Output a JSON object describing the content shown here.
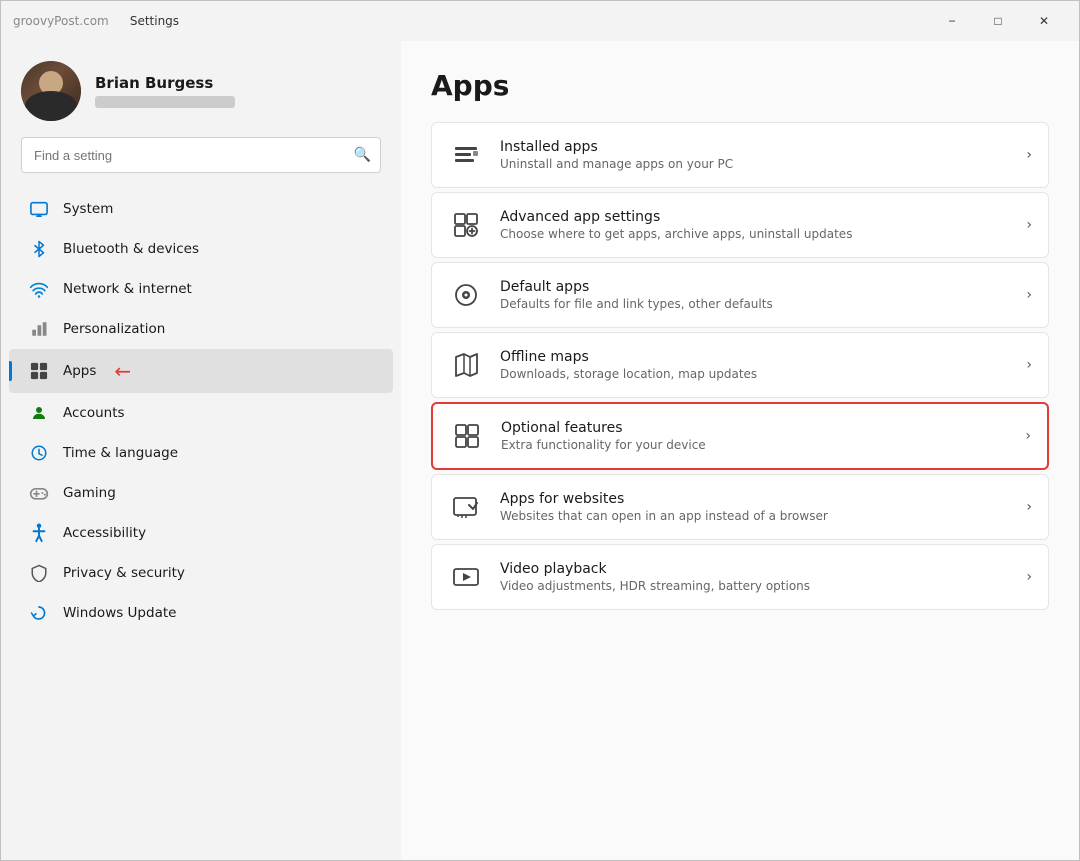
{
  "window": {
    "title": "Settings",
    "watermark": "groovyPost.com"
  },
  "titlebar": {
    "minimize_label": "−",
    "maximize_label": "□",
    "close_label": "✕"
  },
  "sidebar": {
    "user": {
      "name": "Brian Burgess",
      "email_placeholder": "●●●●●●●●●●●●"
    },
    "search": {
      "placeholder": "Find a setting"
    },
    "nav_items": [
      {
        "id": "system",
        "label": "System",
        "icon": "🖥",
        "active": false
      },
      {
        "id": "bluetooth",
        "label": "Bluetooth & devices",
        "icon": "⬡",
        "active": false
      },
      {
        "id": "network",
        "label": "Network & internet",
        "icon": "◈",
        "active": false
      },
      {
        "id": "personalization",
        "label": "Personalization",
        "icon": "✏",
        "active": false
      },
      {
        "id": "apps",
        "label": "Apps",
        "icon": "⊞",
        "active": true
      },
      {
        "id": "accounts",
        "label": "Accounts",
        "icon": "●",
        "active": false
      },
      {
        "id": "time",
        "label": "Time & language",
        "icon": "⊕",
        "active": false
      },
      {
        "id": "gaming",
        "label": "Gaming",
        "icon": "⊛",
        "active": false
      },
      {
        "id": "accessibility",
        "label": "Accessibility",
        "icon": "✶",
        "active": false
      },
      {
        "id": "privacy",
        "label": "Privacy & security",
        "icon": "⊗",
        "active": false
      },
      {
        "id": "windowsupdate",
        "label": "Windows Update",
        "icon": "↺",
        "active": false
      }
    ]
  },
  "main": {
    "page_title": "Apps",
    "settings_items": [
      {
        "id": "installed-apps",
        "title": "Installed apps",
        "desc": "Uninstall and manage apps on your PC",
        "icon": "☰",
        "highlighted": false
      },
      {
        "id": "advanced-app-settings",
        "title": "Advanced app settings",
        "desc": "Choose where to get apps, archive apps, uninstall updates",
        "icon": "⊞",
        "highlighted": false
      },
      {
        "id": "default-apps",
        "title": "Default apps",
        "desc": "Defaults for file and link types, other defaults",
        "icon": "⊙",
        "highlighted": false
      },
      {
        "id": "offline-maps",
        "title": "Offline maps",
        "desc": "Downloads, storage location, map updates",
        "icon": "⊡",
        "highlighted": false
      },
      {
        "id": "optional-features",
        "title": "Optional features",
        "desc": "Extra functionality for your device",
        "icon": "⊞",
        "highlighted": true
      },
      {
        "id": "apps-for-websites",
        "title": "Apps for websites",
        "desc": "Websites that can open in an app instead of a browser",
        "icon": "⊡",
        "highlighted": false
      },
      {
        "id": "video-playback",
        "title": "Video playback",
        "desc": "Video adjustments, HDR streaming, battery options",
        "icon": "⬜",
        "highlighted": false
      }
    ],
    "chevron": "›"
  }
}
